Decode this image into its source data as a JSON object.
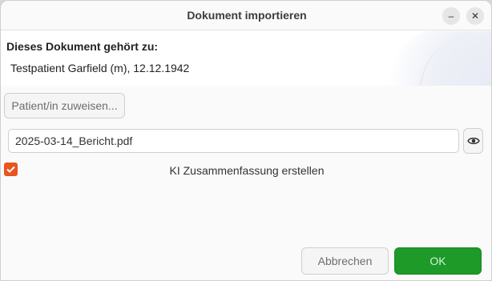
{
  "window": {
    "title": "Dokument importieren",
    "minimize_glyph": "–",
    "close_glyph": "✕"
  },
  "header": {
    "owner_label": "Dieses Dokument gehört zu:",
    "patient": "Testpatient Garfield (m), 12.12.1942"
  },
  "actions": {
    "assign_label": "Patient/in zuweisen..."
  },
  "file": {
    "value": "2025-03-14_Bericht.pdf",
    "preview_icon": "eye-icon"
  },
  "options": {
    "summary_checked": true,
    "summary_label": "KI Zusammenfassung erstellen"
  },
  "footer": {
    "cancel_label": "Abbrechen",
    "ok_label": "OK"
  },
  "colors": {
    "accent": "#e95420",
    "ok": "#1d9a27"
  }
}
